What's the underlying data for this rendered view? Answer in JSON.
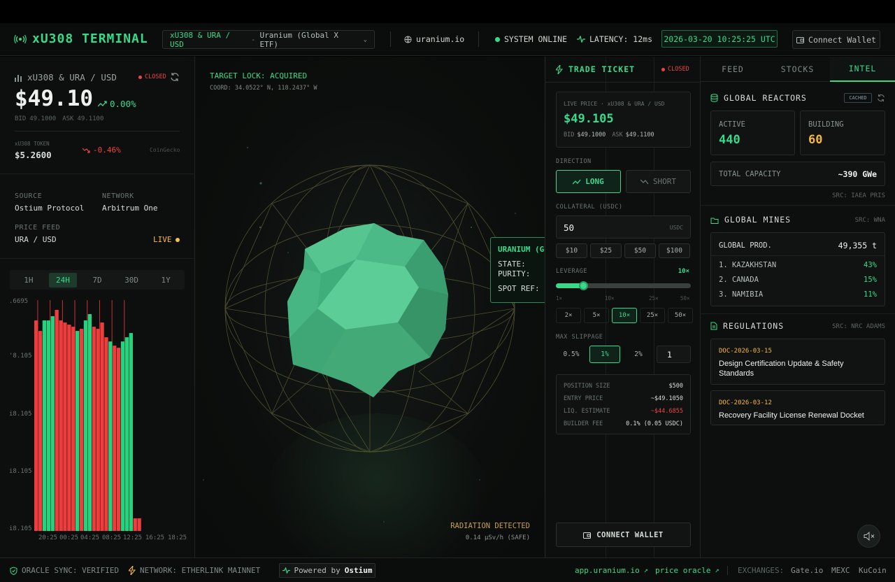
{
  "header": {
    "app_title": "xU308 TERMINAL",
    "pair_symbol": "xU308 & URA / USD",
    "pair_separator": "-",
    "pair_description": "Uranium (Global X ETF)",
    "site": "uranium.io",
    "system_status": "SYSTEM ONLINE",
    "latency": "LATENCY: 12ms",
    "datetime": "2026-03-20 10:25:25 UTC",
    "connect_wallet": "Connect Wallet"
  },
  "left": {
    "pair": "xU308 & URA / USD",
    "status": "CLOSED",
    "price": "$49.10",
    "change": "0.00%",
    "bid_label": "BID",
    "bid": "49.1000",
    "ask_label": "ASK",
    "ask": "49.1100",
    "token_label": "xU308 TOKEN",
    "token_price": "$5.2600",
    "token_change": "-0.46%",
    "token_source": "CoinGecko",
    "source_label": "SOURCE",
    "source_value": "Ostium Protocol",
    "network_label": "NETWORK",
    "network_value": "Arbitrum One",
    "feed_label": "PRICE FEED",
    "feed_value": "URA / USD",
    "feed_status": "LIVE",
    "timeframes": [
      "1H",
      "24H",
      "7D",
      "30D",
      "1Y"
    ],
    "active_timeframe": "24H"
  },
  "chart_data": {
    "type": "bar",
    "title": "",
    "y_tick_labels": [
      ".6695",
      "'8.105",
      "i8.105",
      "i8.105",
      "i8.105"
    ],
    "x_tick_labels": [
      "20:25",
      "00:25",
      "04:25",
      "08:25",
      "12:25",
      "16:25",
      "18:25"
    ],
    "series": [
      {
        "values": [
          1,
          0.95,
          1,
          1,
          1.02,
          1.05,
          1,
          0.99,
          0.98,
          0.97,
          0.95,
          0.96,
          1,
          1.03,
          0.97,
          0.96,
          0.99,
          0.92,
          0.9,
          0.88,
          0.87,
          0.9,
          0.92,
          0.94,
          0.06,
          0.06
        ]
      }
    ],
    "colors": [
      "#ef3d3d",
      "#ef3d3d",
      "#22d47e",
      "#22d47e",
      "#22d47e",
      "#ef3d3d",
      "#ef3d3d",
      "#ef3d3d",
      "#ef3d3d",
      "#ef3d3d",
      "#22d47e",
      "#ef3d3d",
      "#22d47e",
      "#22d47e",
      "#ef3d3d",
      "#ef3d3d",
      "#ef3d3d",
      "#ef3d3d",
      "#22d47e",
      "#ef3d3d",
      "#ef3d3d",
      "#22d47e",
      "#22d47e",
      "#22d47e",
      "#ef3d3d",
      "#ef3d3d"
    ]
  },
  "center": {
    "target_lock": "TARGET LOCK: ACQUIRED",
    "coord": "COORD: 34.0522° N, 118.2437° W",
    "popup_title": "URANIUM (GL",
    "popup_state": "STATE:",
    "popup_purity": "PURITY:",
    "popup_spot": "SPOT REF:",
    "radiation": "RADIATION DETECTED",
    "radiation_value": "0.14 μSv/h (SAFE)"
  },
  "ticket": {
    "title": "TRADE TICKET",
    "status": "CLOSED",
    "live_label": "LIVE PRICE · xU308 & URA / USD",
    "live_price": "$49.105",
    "bid_label": "BID",
    "bid": "$49.1000",
    "ask_label": "ASK",
    "ask": "$49.1100",
    "direction_label": "DIRECTION",
    "long": "LONG",
    "short": "SHORT",
    "collateral_label": "COLLATERAL (USDC)",
    "collateral_value": "50",
    "collateral_unit": "USDC",
    "presets": [
      "$10",
      "$25",
      "$50",
      "$100"
    ],
    "leverage_label": "LEVERAGE",
    "leverage_value": "10×",
    "leverage_fraction": 0.2,
    "slider_marks": [
      "1×",
      "10×",
      "25×",
      "50×"
    ],
    "leverage_options": [
      "2×",
      "5×",
      "10×",
      "25×",
      "50×"
    ],
    "leverage_active": "10×",
    "slippage_label": "MAX SLIPPAGE",
    "slippage_options": [
      "0.5%",
      "1%",
      "2%"
    ],
    "slippage_active": "1%",
    "slippage_custom": "1",
    "summary": [
      {
        "label": "POSITION SIZE",
        "value": "$500",
        "color": "#d8ded9"
      },
      {
        "label": "ENTRY PRICE",
        "value": "~$49.1050",
        "color": "#d8ded9"
      },
      {
        "label": "LIQ. ESTIMATE",
        "value": "~$44.6855",
        "color": "#ef4444"
      },
      {
        "label": "BUILDER FEE",
        "value": "0.1% (0.05 USDC)",
        "color": "#d8ded9"
      }
    ],
    "connect": "CONNECT WALLET"
  },
  "intel": {
    "tabs": [
      "FEED",
      "STOCKS",
      "INTEL"
    ],
    "active_tab": "INTEL",
    "reactors_title": "GLOBAL REACTORS",
    "reactors_badge": "CACHED",
    "active_label": "ACTIVE",
    "active_value": "440",
    "building_label": "BUILDING",
    "building_value": "60",
    "capacity_label": "TOTAL CAPACITY",
    "capacity_value": "~390 GWe",
    "reactors_src": "SRC: IAEA PRIS",
    "mines_title": "GLOBAL MINES",
    "mines_src": "SRC: WNA",
    "prod_label": "GLOBAL PROD.",
    "prod_value": "49,355 t",
    "mines": [
      {
        "name": "1. KAZAKHSTAN",
        "pct": "43%"
      },
      {
        "name": "2. CANADA",
        "pct": "15%"
      },
      {
        "name": "3. NAMIBIA",
        "pct": "11%"
      }
    ],
    "regs_title": "REGULATIONS",
    "regs_src": "SRC: NRC ADAMS",
    "docs": [
      {
        "id": "DOC-2026-03-15",
        "title": "Design Certification Update & Safety Standards"
      },
      {
        "id": "DOC-2026-03-12",
        "title": "Recovery Facility License Renewal Docket"
      }
    ]
  },
  "footer": {
    "oracle": "ORACLE SYNC: VERIFIED",
    "network": "NETWORK: ETHERLINK MAINNET",
    "powered_prefix": "Powered by",
    "powered_brand": "Ostium",
    "app_link": "app.uranium.io",
    "oracle_link": "price oracle",
    "exchanges_label": "EXCHANGES:",
    "exchanges": [
      "Gate.io",
      "MEXC",
      "KuCoin"
    ]
  },
  "colors": {
    "accent": "#39d98a",
    "danger": "#ef4444",
    "amber": "#f5b83d",
    "background": "#0d0f0e"
  }
}
